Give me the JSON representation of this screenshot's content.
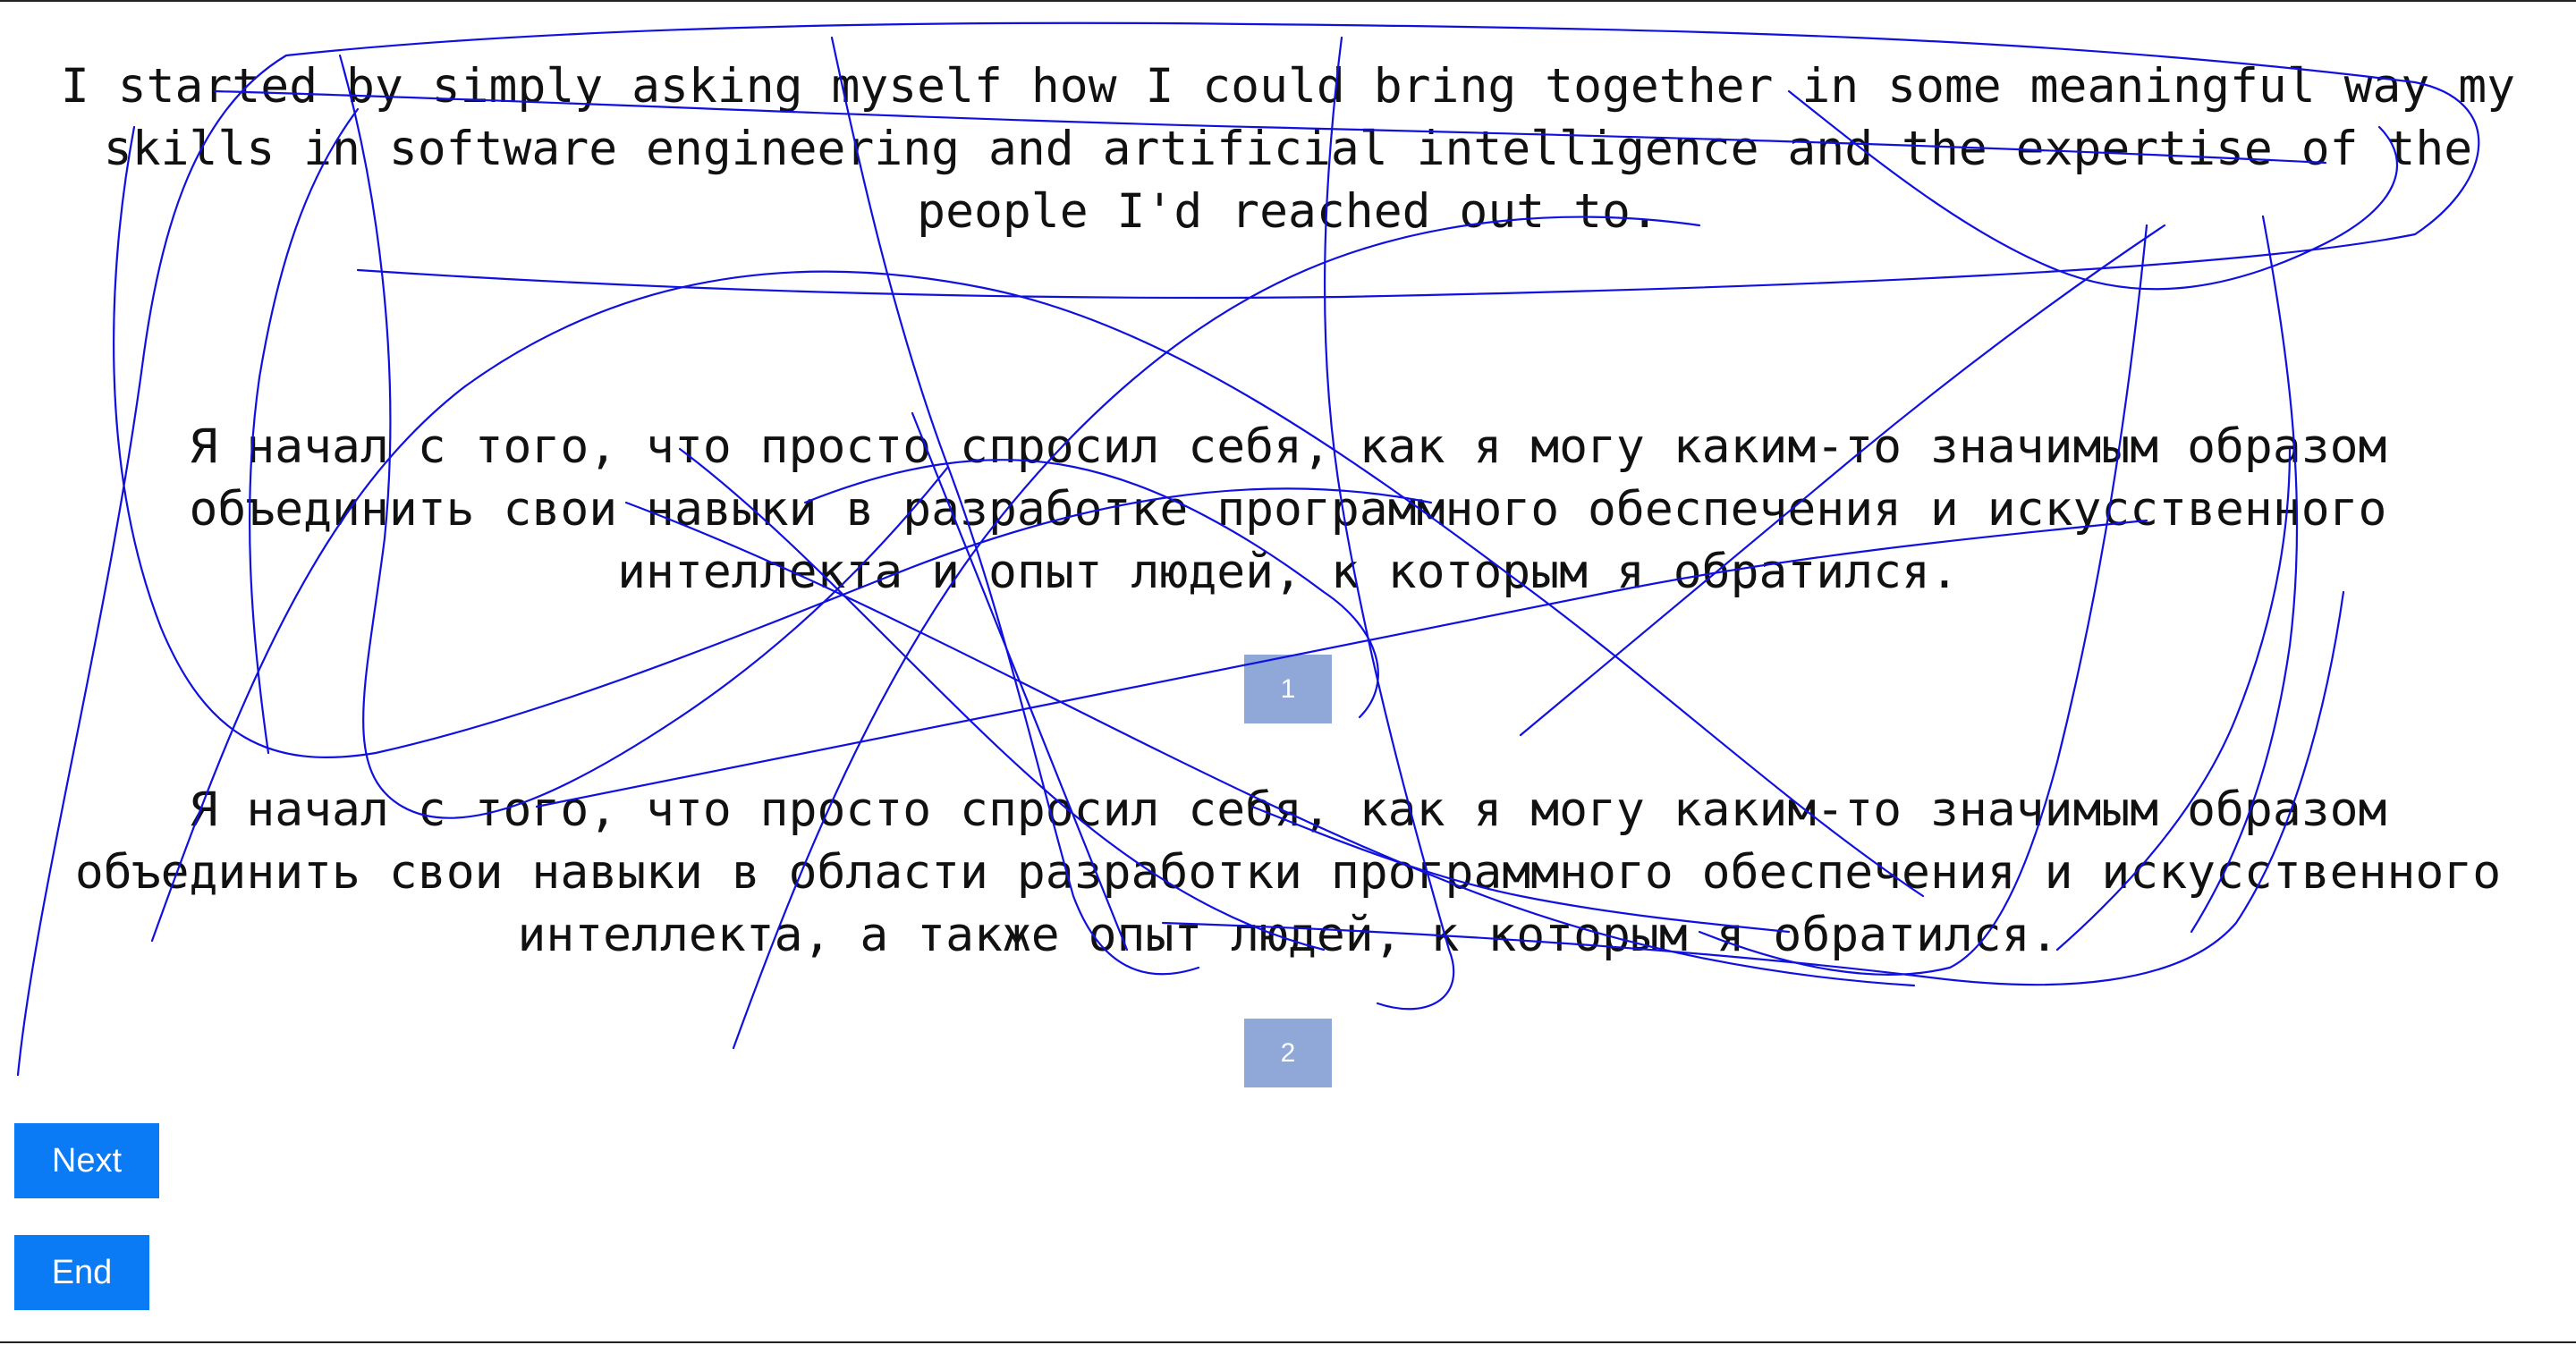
{
  "source": {
    "text": "I started by simply asking myself how I could bring together in some meaningful way my\nskills in software engineering and artificial intelligence and the expertise of the\npeople I'd reached out to."
  },
  "options": [
    {
      "text": "Я начал с того, что просто спросил себя, как я могу каким-то значимым образом\nобъединить свои навыки в разработке программного обеспечения и искусственного\nинтеллекта и опыт людей, к которым я обратился.",
      "label": "1"
    },
    {
      "text": "Я начал с того, что просто спросил себя, как я могу каким-то значимым образом\nобъединить свои навыки в области разработки программного обеспечения и искусственного\nинтеллекта, а также опыт людей, к которым я обратился.",
      "label": "2"
    }
  ],
  "controls": {
    "next_label": "Next",
    "end_label": "End"
  },
  "colors": {
    "choice_button": "#8fa8d8",
    "action_button": "#0a7af5",
    "annotation_ink": "#1010e0"
  }
}
